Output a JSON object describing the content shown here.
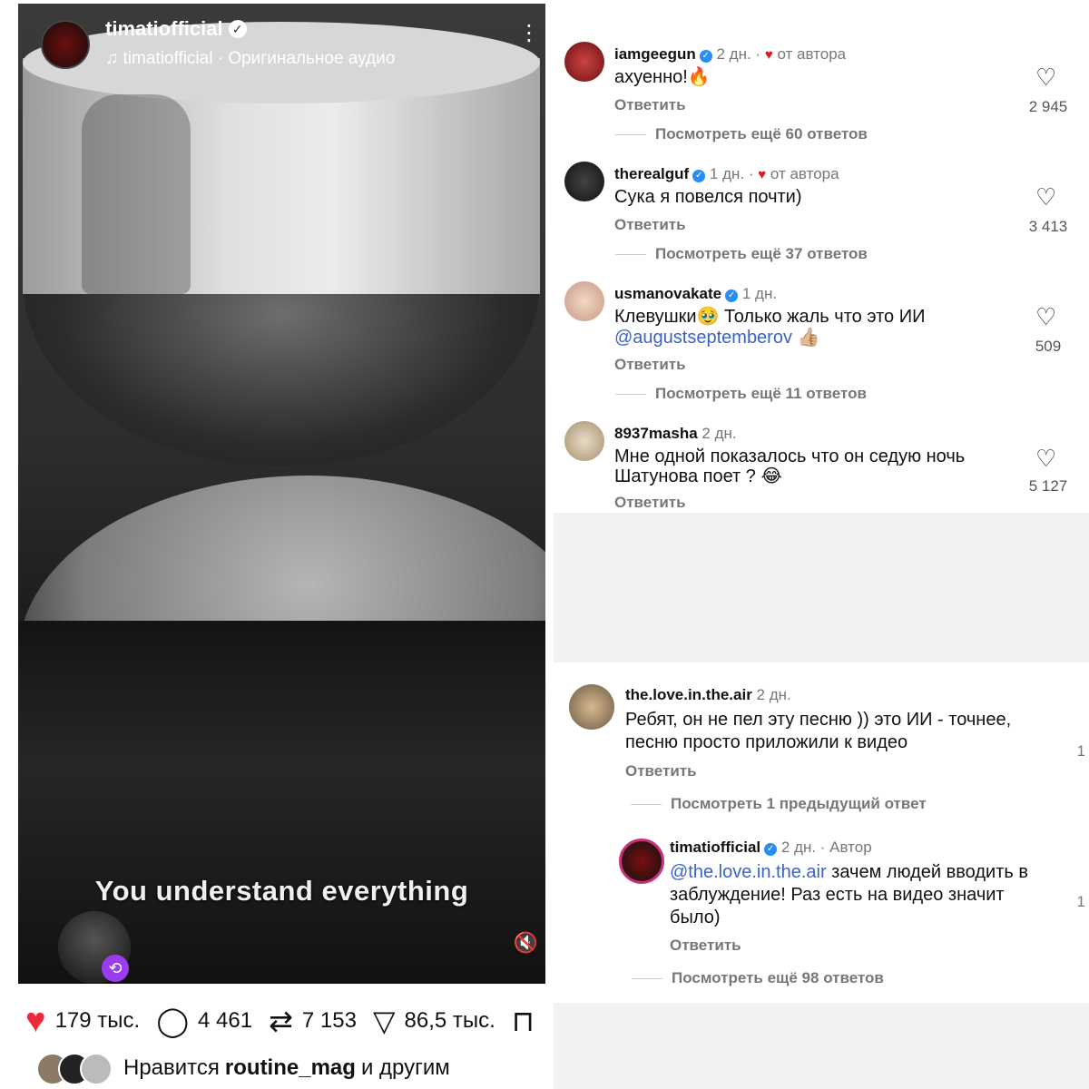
{
  "post": {
    "username": "timatiofficial",
    "audio": "timatiofficial · Оригинальное аудио",
    "caption": "You understand everything",
    "likes": "179 тыс.",
    "comments": "4 461",
    "reposts": "7 153",
    "shares": "86,5 тыс.",
    "liked_by_prefix": "Нравится",
    "liked_by_user": "routine_mag",
    "liked_by_suffix": "и другим"
  },
  "icons": {
    "heart": "heart-filled-icon",
    "comment": "comment-icon",
    "repost": "repost-icon",
    "share": "share-icon",
    "save": "bookmark-icon",
    "mute": "mute-icon"
  },
  "colors": {
    "like_red": "#ed2a3b",
    "verified": "#2a8df5",
    "link": "#3a62c8",
    "repost_badge": "#9b3cf0"
  },
  "comments_top": [
    {
      "user": "iamgeegun",
      "time": "2 дн.",
      "author_tag": "от автора",
      "text": "ахуенно!🔥",
      "reply": "Ответить",
      "likes": "2 945",
      "more": "Посмотреть ещё 60 ответов"
    },
    {
      "user": "therealguf",
      "time": "1 дн.",
      "author_tag": "от автора",
      "text": "Сука я повелся почти)",
      "reply": "Ответить",
      "likes": "3 413",
      "more": "Посмотреть ещё 37 ответов"
    },
    {
      "user": "usmanovakate",
      "time": "1 дн.",
      "text": "Клевушки🥹 Только жаль что это ИИ",
      "mention": "@augustseptemberov",
      "mention_emoji": "👍🏼",
      "reply": "Ответить",
      "likes": "509",
      "more": "Посмотреть ещё 11 ответов"
    },
    {
      "user": "8937masha",
      "time": "2 дн.",
      "text1": "Мне одной показалось что он седую ночь",
      "text2": "Шатунова поет ? 😂",
      "reply": "Ответить",
      "likes": "5 127"
    }
  ],
  "comments_bottom": {
    "main": {
      "user": "the.love.in.the.air",
      "time": "2 дн.",
      "text1": "Ребят, он не пел эту песню )) это ИИ - точнее,",
      "text2": "песню просто приложили к видео",
      "reply": "Ответить",
      "prev": "Посмотреть 1 предыдущий ответ",
      "edge": "1"
    },
    "reply": {
      "user": "timatiofficial",
      "time": "2 дн. · Автор",
      "mention": "@the.love.in.the.air",
      "text1": " зачем людей вводить в",
      "text2": "заблуждение! Раз есть на видео значит",
      "text3": "было)",
      "reply": "Ответить",
      "more": "Посмотреть ещё 98 ответов",
      "edge": "1"
    }
  }
}
